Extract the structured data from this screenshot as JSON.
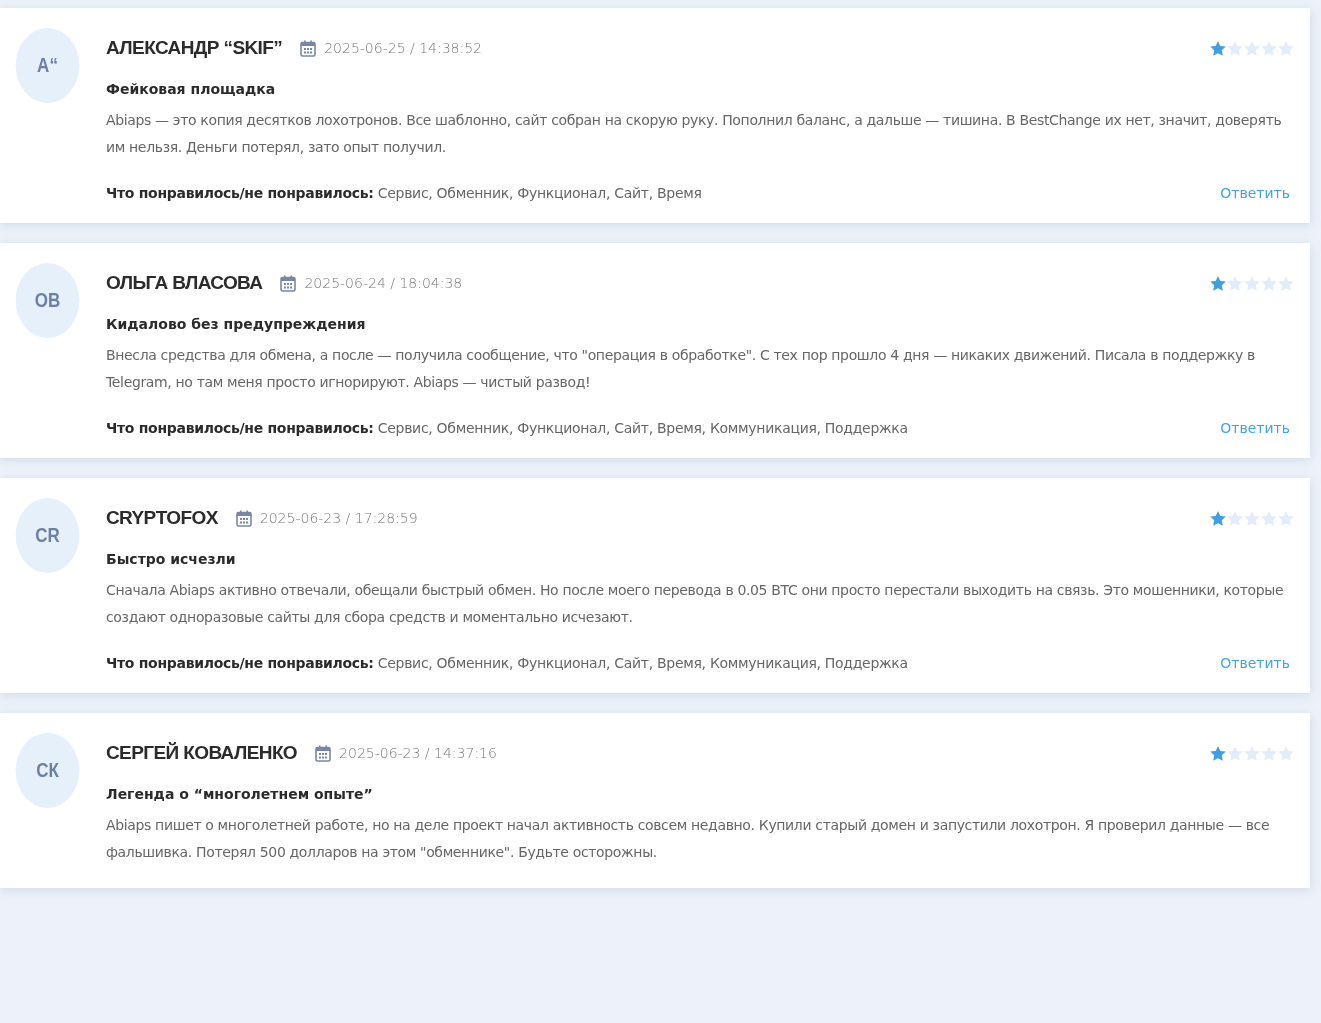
{
  "reviews": [
    {
      "initials": "А“",
      "name": "АЛЕКСАНДР “SKIF”",
      "date": "2025-06-25 / 14:38:52",
      "stars": 1,
      "title": "Фейковая площадка",
      "text": "Abiaps — это копия десятков лохотронов. Все шаблонно, сайт собран на скорую руку. Пополнил баланс, а дальше — тишина. В BestChange их нет, значит, доверять им нельзя. Деньги потерял, зато опыт получил.",
      "likes_label": "Что понравилось/не понравилось:",
      "likes": "Сервис, Обменник, Функционал, Сайт, Время",
      "reply": "Ответить"
    },
    {
      "initials": "ОВ",
      "name": "ОЛЬГА ВЛАСОВА",
      "date": "2025-06-24 / 18:04:38",
      "stars": 1,
      "title": "Кидалово без предупреждения",
      "text": "Внесла средства для обмена, а после — получила сообщение, что \"операция в обработке\". С тех пор прошло 4 дня — никаких движений. Писала в поддержку в Telegram, но там меня просто игнорируют. Abiaps — чистый развод!",
      "likes_label": "Что понравилось/не понравилось:",
      "likes": "Сервис, Обменник, Функционал, Сайт, Время, Коммуникация, Поддержка",
      "reply": "Ответить"
    },
    {
      "initials": "CR",
      "name": "CRYPTOFOX",
      "date": "2025-06-23 / 17:28:59",
      "stars": 1,
      "title": "Быстро исчезли",
      "text": "Сначала Abiaps активно отвечали, обещали быстрый обмен. Но после моего перевода в 0.05 BTC они просто перестали выходить на связь. Это мошенники, которые создают одноразовые сайты для сбора средств и моментально исчезают.",
      "likes_label": "Что понравилось/не понравилось:",
      "likes": "Сервис, Обменник, Функционал, Сайт, Время, Коммуникация, Поддержка",
      "reply": "Ответить"
    },
    {
      "initials": "СК",
      "name": "СЕРГЕЙ КОВАЛЕНКО",
      "date": "2025-06-23 / 14:37:16",
      "stars": 1,
      "title": "Легенда о “многолетнем опыте”",
      "text": "Abiaps пишет о многолетней работе, но на деле проект начал активность совсем недавно. Купили старый домен и запустили лохотрон. Я проверил данные — все фальшивка. Потерял 500 долларов на этом \"обменнике\". Будьте осторожны."
    }
  ]
}
